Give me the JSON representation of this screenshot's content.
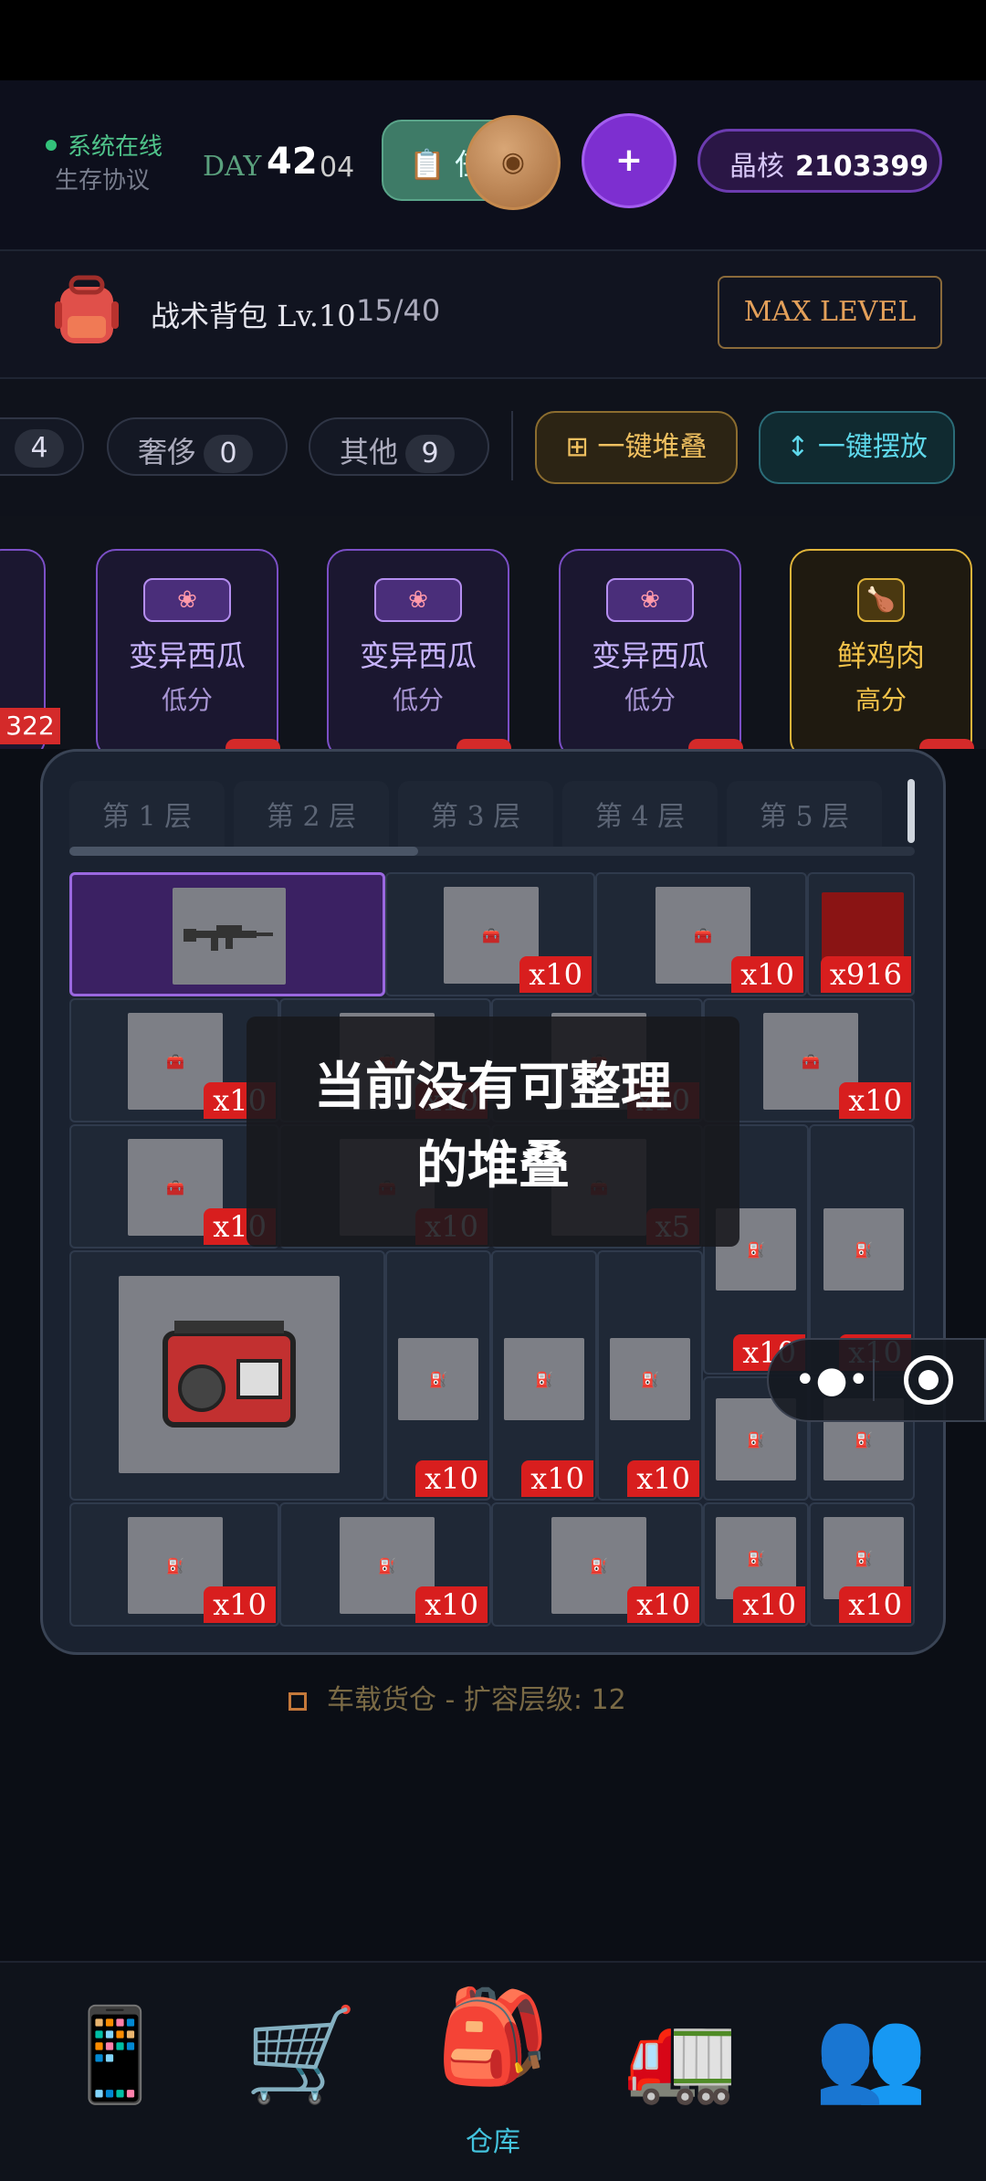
{
  "header": {
    "status": "系统在线",
    "protocol": "生存协议",
    "day_label": "DAY",
    "day_number": "42",
    "day_sub": "04",
    "task_label": "任",
    "plus_label": "+",
    "crystal_label": "晶核",
    "crystal_value": "2103399"
  },
  "backpack": {
    "title": "战术背包 Lv.10",
    "count": "15/40",
    "max_level": "MAX LEVEL"
  },
  "filters": [
    {
      "label": "",
      "count": "4"
    },
    {
      "label": "奢侈",
      "count": "0"
    },
    {
      "label": "其他",
      "count": "9"
    }
  ],
  "actions": {
    "stack_all": "⊞ 一键堆叠",
    "place_all": "↕ 一键摆放"
  },
  "item_cards": [
    {
      "name": "变异西瓜",
      "quality": "低分",
      "type": "purple"
    },
    {
      "name": "变异西瓜",
      "quality": "低分",
      "type": "purple"
    },
    {
      "name": "变异西瓜",
      "quality": "低分",
      "type": "purple"
    },
    {
      "name": "鲜鸡肉",
      "quality": "高分",
      "type": "gold"
    }
  ],
  "left_card_badge": "322",
  "storage": {
    "tabs": [
      "第 1 层",
      "第 2 层",
      "第 3 层",
      "第 4 层",
      "第 5 层"
    ],
    "quantities": {
      "r1_toolbox1": "x10",
      "r1_toolbox2": "x10",
      "r1_meat": "x916",
      "r2_a": "x10",
      "r2_b": "x10",
      "r2_c": "x10",
      "r2_d": "x10",
      "r3_a": "x10",
      "r3_b": "x10",
      "r3_c": "x5",
      "can_a": "x10",
      "can_b": "x10",
      "can_c": "x10",
      "can_d": "x10",
      "can_e": "x10",
      "can_f": "x10",
      "can_g": "x10",
      "can_h": "x10",
      "can_i": "x10",
      "can_j": "x10"
    },
    "overlay_line1": "当前没有可整理",
    "overlay_line2": "的堆叠",
    "footer": "车载货仓 - 扩容层级: 12"
  },
  "nav": {
    "active_label": "仓库",
    "icons": [
      "phone-icon",
      "cart-icon",
      "backpack-icon",
      "truck-icon",
      "users-icon"
    ]
  },
  "colors": {
    "qty_badge": "#d81e1e",
    "accent_purple": "#7d2fd0",
    "accent_gold": "#e0b43a",
    "accent_cyan": "#43c3dd"
  }
}
